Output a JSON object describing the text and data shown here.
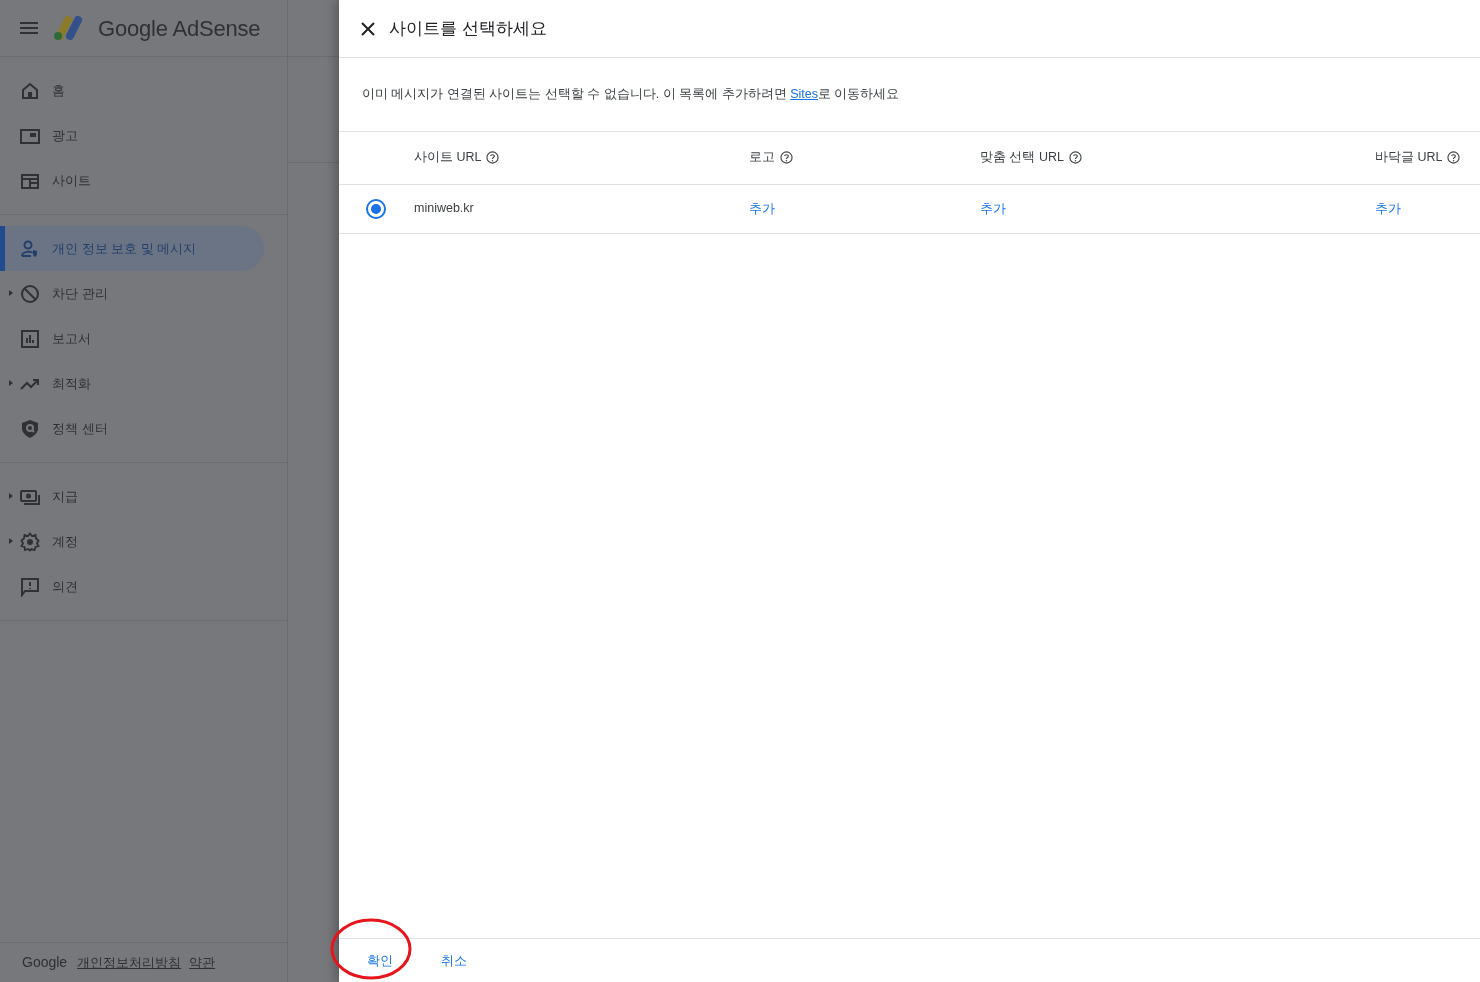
{
  "app": {
    "brand": "Google AdSense"
  },
  "sidebar": {
    "sections": [
      [
        {
          "label": "홈",
          "expandable": false,
          "selected": false
        },
        {
          "label": "광고",
          "expandable": false,
          "selected": false
        },
        {
          "label": "사이트",
          "expandable": false,
          "selected": false
        }
      ],
      [
        {
          "label": "개인 정보 보호 및 메시지",
          "expandable": false,
          "selected": true
        },
        {
          "label": "차단 관리",
          "expandable": true,
          "selected": false
        },
        {
          "label": "보고서",
          "expandable": false,
          "selected": false
        },
        {
          "label": "최적화",
          "expandable": true,
          "selected": false
        },
        {
          "label": "정책 센터",
          "expandable": false,
          "selected": false
        }
      ],
      [
        {
          "label": "지급",
          "expandable": true,
          "selected": false
        },
        {
          "label": "계정",
          "expandable": true,
          "selected": false
        },
        {
          "label": "의견",
          "expandable": false,
          "selected": false
        }
      ]
    ]
  },
  "footer": {
    "brand": "Google",
    "links": [
      "개인정보처리방침",
      "약관"
    ]
  },
  "dialog": {
    "title": "사이트를 선택하세요",
    "notice": {
      "before": "이미 메시지가 연결된 사이트는 선택할 수 없습니다. 이 목록에 추가하려면 ",
      "link": "Sites",
      "after": "로 이동하세요"
    },
    "table": {
      "columns": [
        "사이트 URL",
        "로고",
        "맞춤 선택 URL",
        "바닥글 URL"
      ],
      "rows": [
        {
          "selected": true,
          "site": "miniweb.kr",
          "logo": "추가",
          "custom_url": "추가",
          "footer_url": "추가"
        }
      ]
    },
    "actions": [
      {
        "label": "확인",
        "circled": true
      },
      {
        "label": "취소",
        "circled": false
      }
    ]
  }
}
